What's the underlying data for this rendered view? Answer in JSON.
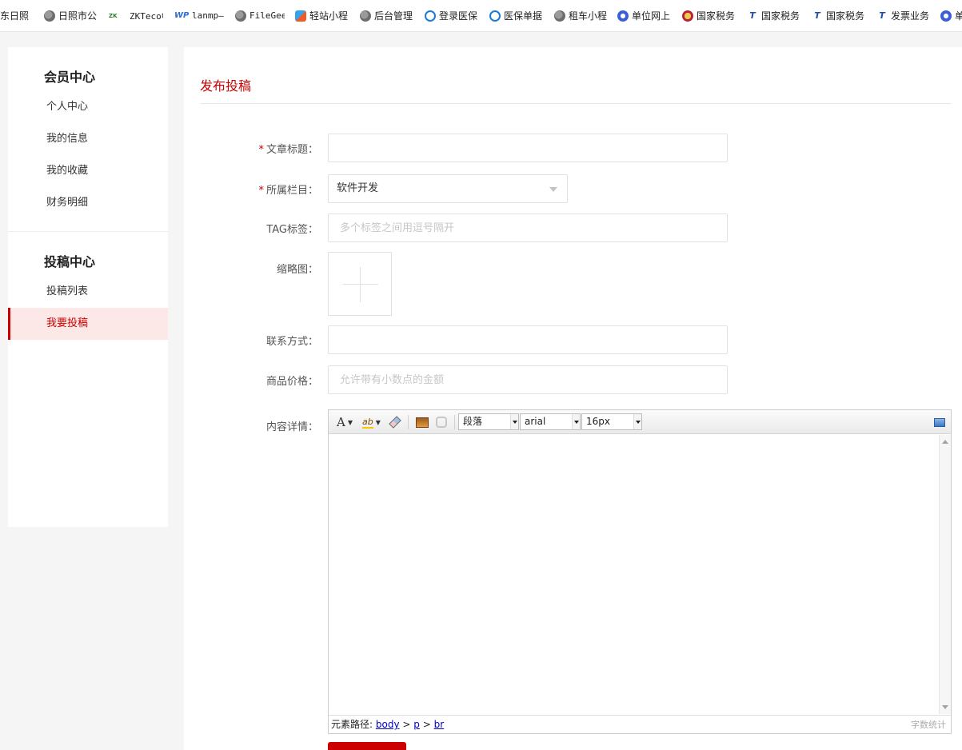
{
  "bookmarks": [
    {
      "label": "山东日照",
      "icon": "globe-icon"
    },
    {
      "label": "日照市公",
      "icon": "globe-icon"
    },
    {
      "label": "ZKTeco中",
      "icon": "zkteco-icon"
    },
    {
      "label": "lanmp—",
      "icon": "wordpress-icon"
    },
    {
      "label": "FileGee",
      "icon": "globe-icon"
    },
    {
      "label": "轻站小程",
      "icon": "qingzhan-icon"
    },
    {
      "label": "后台管理",
      "icon": "globe-icon"
    },
    {
      "label": "登录医保",
      "icon": "medical-insurance-icon"
    },
    {
      "label": "医保单据",
      "icon": "medical-insurance-icon"
    },
    {
      "label": "租车小程",
      "icon": "globe-icon"
    },
    {
      "label": "单位网上",
      "icon": "world-icon"
    },
    {
      "label": "国家税务",
      "icon": "tax-emblem-icon"
    },
    {
      "label": "国家税务",
      "icon": "tax-logo-icon"
    },
    {
      "label": "国家税务",
      "icon": "tax-logo-icon"
    },
    {
      "label": "发票业务",
      "icon": "tax-logo-icon"
    },
    {
      "label": "单",
      "icon": "world-icon"
    }
  ],
  "sidebar": {
    "member_title": "会员中心",
    "member_items": [
      "个人中心",
      "我的信息",
      "我的收藏",
      "财务明细"
    ],
    "contrib_title": "投稿中心",
    "contrib_items": [
      "投稿列表",
      "我要投稿"
    ],
    "active_item": "我要投稿"
  },
  "main": {
    "title": "发布投稿",
    "form": {
      "article_title_label": "文章标题：",
      "article_title_value": "",
      "category_label": "所属栏目：",
      "category_value": "软件开发",
      "tag_label": "TAG标签：",
      "tag_placeholder": "多个标签之间用逗号隔开",
      "thumbnail_label": "缩略图：",
      "contact_label": "联系方式：",
      "contact_value": "",
      "price_label": "商品价格：",
      "price_placeholder": "允许带有小数点的金额",
      "content_label": "内容详情：",
      "required_mark": "*"
    },
    "editor": {
      "toolbar": {
        "font_color_glyph": "A",
        "highlight_glyph": "ab",
        "paragraph_select": "段落",
        "font_family_select": "arial",
        "font_size_select": "16px"
      },
      "path_label": "元素路径:",
      "path": [
        "body",
        "p",
        "br"
      ],
      "path_separator": ">",
      "word_count_label": "字数统计"
    }
  },
  "colors": {
    "accent": "#cc0000",
    "active_bg": "#fde8e8",
    "page_bg": "#f5f5f5"
  }
}
